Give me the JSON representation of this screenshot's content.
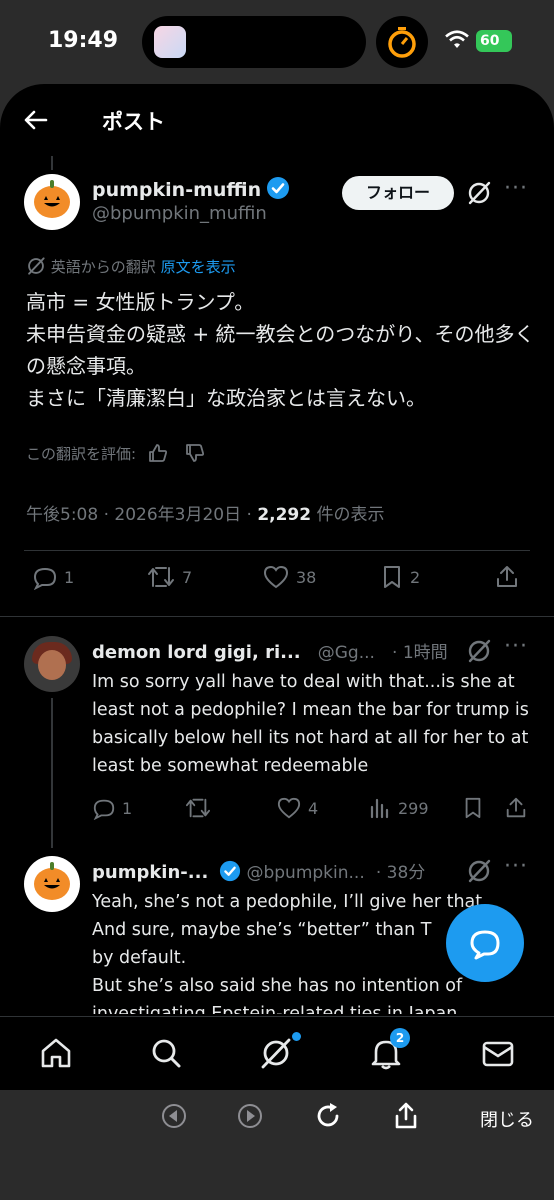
{
  "status": {
    "time": "19:49",
    "battery": "60"
  },
  "header": {
    "title": "ポスト"
  },
  "post": {
    "name": "pumpkin-muffin",
    "handle": "@bpumpkin_muffin",
    "follow_label": "フォロー",
    "translate_note": "英語からの翻訳",
    "show_original": "原文を表示",
    "text": "高市 = 女性版トランプ。\n未申告資金の疑惑 + 統一教会とのつながり、その他多くの懸念事項。\nまさに「清廉潔白」な政治家とは言えない。",
    "rate_label": "この翻訳を評価:",
    "timestamp": "午後5:08 · 2026年3月20日 · ",
    "views_count": "2,292",
    "views_label": " 件の表示",
    "replies": "1",
    "reposts": "7",
    "likes": "38",
    "bookmarks": "2"
  },
  "replies": [
    {
      "name": "demon lord gigi, ri...",
      "handle": "@Gg...",
      "time": "· 1時間",
      "text": "Im so sorry yall have to deal with that...is she at least not a pedophile? I mean the bar for trump is basically below hell its not hard at all for her to at least be somewhat redeemable",
      "replies": "1",
      "likes": "4",
      "views": "299"
    },
    {
      "name": "pumpkin-...",
      "handle": "@bpumpkin...",
      "time": "· 38分",
      "text": "Yeah, she’s not a pedophile, I’ll give her that.\nAnd sure, maybe she’s “better” than T\nby default.\nBut she’s also said she has no intention of\ninvestigating Epstein-related ties in Japan"
    }
  ],
  "tabbar": {
    "notification_count": "2"
  },
  "browser": {
    "close_label": "閉じる"
  },
  "colors": {
    "accent": "#1d9bf0",
    "background": "#000000",
    "muted": "#71767b"
  }
}
